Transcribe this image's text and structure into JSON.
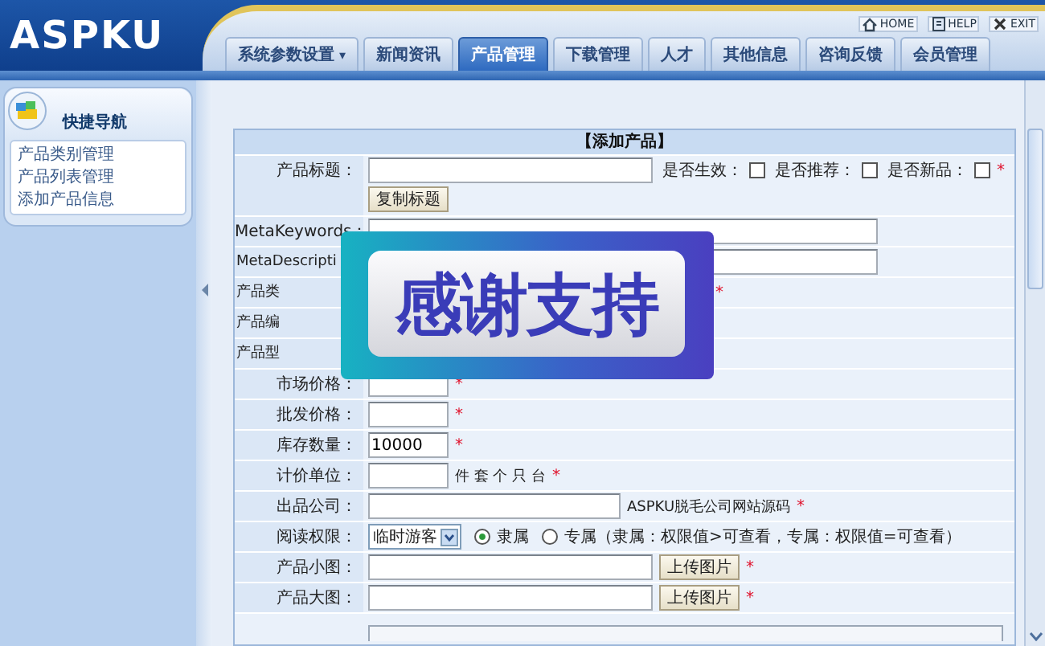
{
  "header": {
    "logo": "ASPKU",
    "tabs": [
      {
        "label": "系统参数设置",
        "selected": false,
        "dropdown": "▾"
      },
      {
        "label": "新闻资讯",
        "selected": false
      },
      {
        "label": "产品管理",
        "selected": true
      },
      {
        "label": "下载管理",
        "selected": false
      },
      {
        "label": "人才",
        "selected": false
      },
      {
        "label": "其他信息",
        "selected": false
      },
      {
        "label": "咨询反馈",
        "selected": false
      },
      {
        "label": "会员管理",
        "selected": false
      }
    ],
    "top_links": [
      {
        "kind": "home",
        "label": "HOME"
      },
      {
        "kind": "help",
        "label": "HELP"
      },
      {
        "kind": "exit",
        "label": "EXIT"
      }
    ]
  },
  "sidebar": {
    "title": "快捷导航",
    "items": [
      "产品类别管理",
      "产品列表管理",
      "添加产品信息"
    ]
  },
  "form": {
    "title": "【添加产品】",
    "rows": [
      {
        "kind": "title",
        "label": "产品标题：",
        "checks": [
          {
            "label": "是否生效：",
            "checked": false
          },
          {
            "label": "是否推荐：",
            "checked": false
          },
          {
            "label": "是否新品：",
            "checked": false
          }
        ],
        "mark": "*",
        "button": "复制标题"
      },
      {
        "kind": "wide",
        "label": "MetaKeywords："
      },
      {
        "kind": "clipped",
        "label": "MetaDescripti"
      },
      {
        "kind": "hidden",
        "label": "产品类",
        "mark": "*"
      },
      {
        "kind": "hidden",
        "label": "产品编"
      },
      {
        "kind": "hidden",
        "label": "产品型"
      },
      {
        "kind": "short",
        "label": "市场价格：",
        "mark": "*"
      },
      {
        "kind": "short",
        "label": "批发价格：",
        "mark": "*"
      },
      {
        "kind": "short",
        "label": "库存数量：",
        "value": "10000",
        "mark": "*"
      },
      {
        "kind": "short",
        "label": "计价单位：",
        "note": "件 套 个 只 台",
        "mark": "*"
      },
      {
        "kind": "mid",
        "label": "出品公司：",
        "note": "ASPKU脱毛公司网站源码",
        "mark": "*"
      },
      {
        "kind": "access",
        "label": "阅读权限：",
        "select": "临时游客",
        "radios": [
          {
            "label": "隶属",
            "selected": true
          },
          {
            "label": "专属（隶属：权限值>可查看，专属：权限值=可查看）",
            "selected": false
          }
        ]
      },
      {
        "kind": "upload",
        "label": "产品小图：",
        "button": "上传图片",
        "mark": "*"
      },
      {
        "kind": "upload",
        "label": "产品大图：",
        "button": "上传图片",
        "mark": "*"
      },
      {
        "kind": "area"
      }
    ]
  },
  "overlay": {
    "text": "感谢支持"
  }
}
